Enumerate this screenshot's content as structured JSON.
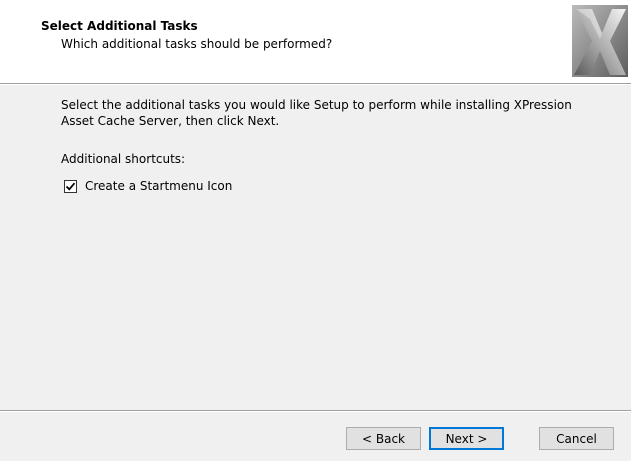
{
  "header": {
    "title": "Select Additional Tasks",
    "subtitle": "Which additional tasks should be performed?",
    "logo_icon": "xpression-x-logo-icon"
  },
  "body": {
    "instruction_line1": "Select the additional tasks you would like Setup to perform while installing XPression",
    "instruction_line2": "Asset Cache Server, then click Next.",
    "group_label": "Additional shortcuts:",
    "tasks": [
      {
        "label": "Create a Startmenu Icon",
        "checked": true
      }
    ]
  },
  "buttons": {
    "back_label": "< Back",
    "next_label": "Next >",
    "cancel_label": "Cancel"
  },
  "colors": {
    "accent": "#0078d7",
    "window_bg": "#f0f0f0",
    "header_bg": "#ffffff"
  }
}
